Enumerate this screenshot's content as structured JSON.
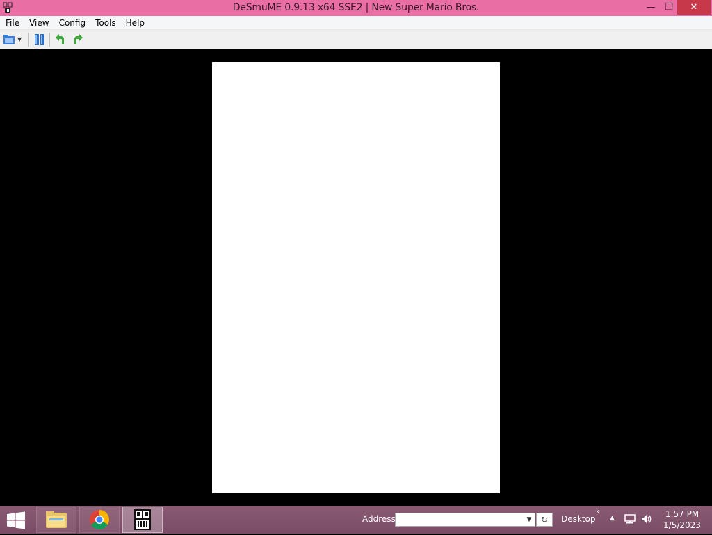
{
  "window": {
    "title": "DeSmuME 0.9.13 x64 SSE2 | New Super Mario Bros.",
    "minimize_glyph": "—",
    "maximize_glyph": "❐",
    "close_glyph": "✕"
  },
  "menubar": {
    "items": [
      "File",
      "View",
      "Config",
      "Tools",
      "Help"
    ]
  },
  "taskbar": {
    "apps": [
      "file-explorer-icon",
      "chrome-icon",
      "desmume-icon"
    ],
    "address_label": "Address",
    "address_value": "",
    "desktop_label": "Desktop",
    "chevron": "»",
    "tray_up": "▲",
    "refresh_glyph": "↻",
    "dropdown_glyph": "▼",
    "time": "1:57 PM",
    "date": "1/5/2023"
  }
}
